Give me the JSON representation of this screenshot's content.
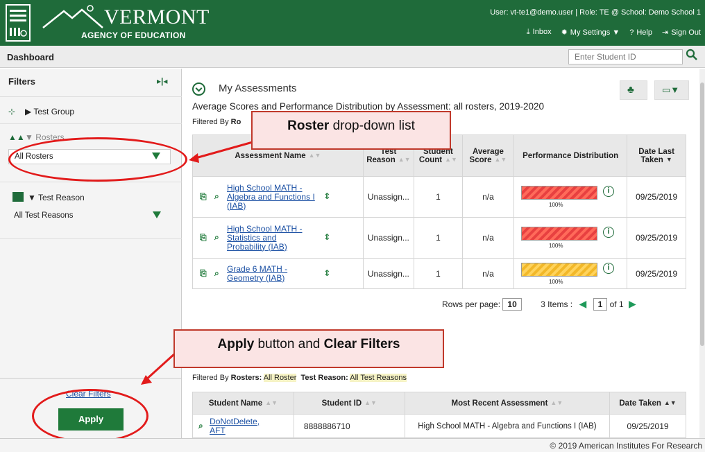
{
  "header": {
    "logo_line1": "VERMONT",
    "logo_line2": "AGENCY OF EDUCATION",
    "user_line": "User: vt-te1@demo.user  |  Role: TE @ School: Demo School 1",
    "links": {
      "inbox": "Inbox",
      "settings": "My Settings ▼",
      "help": "Help",
      "sign_out": "Sign Out"
    }
  },
  "dashboard": {
    "title": "Dashboard",
    "search_placeholder": "Enter Student ID"
  },
  "sidebar": {
    "title": "Filters",
    "test_group": "Test Group",
    "rosters_label": "Rosters",
    "rosters_value": "All Rosters",
    "test_reason_label": "Test Reason",
    "test_reason_value": "All Test Reasons",
    "clear_filters": "Clear Filters",
    "apply": "Apply"
  },
  "main": {
    "title": "My Assessments",
    "subtitle": "Average Scores and Performance Distribution by Assessment: all rosters, 2019-2020",
    "filtered_by_prefix": "Filtered By",
    "filtered_by_rosters": "Ro",
    "columns": [
      "Assessment Name",
      "Test Reason",
      "Student Count",
      "Average Score",
      "Performance Distribution",
      "Date Last Taken"
    ],
    "rows": [
      {
        "name": "High School MATH - Algebra and Functions I (IAB)",
        "reason": "Unassign...",
        "count": "1",
        "score": "n/a",
        "pct": "100%",
        "color": "#e84040",
        "date": "09/25/2019"
      },
      {
        "name": "High School MATH - Statistics and Probability (IAB)",
        "reason": "Unassign...",
        "count": "1",
        "score": "n/a",
        "pct": "100%",
        "color": "#e84040",
        "date": "09/25/2019"
      },
      {
        "name": "Grade 6 MATH - Geometry (IAB)",
        "reason": "Unassign...",
        "count": "1",
        "score": "n/a",
        "pct": "100%",
        "color": "#f2b829",
        "date": "09/25/2019"
      }
    ],
    "rows_per_page_label": "Rows per page:",
    "rows_per_page": "10",
    "items": "3 Items :",
    "page": "1",
    "of_pages": "of 1"
  },
  "students": {
    "filtered_by_prefix": "Filtered By",
    "rosters_label": "Rosters:",
    "rosters_value": "All Roster",
    "test_reason_label": "Test Reason:",
    "test_reason_value": "All Test Reasons",
    "columns": [
      "Student Name",
      "Student ID",
      "Most Recent Assessment",
      "Date Taken"
    ],
    "rows": [
      {
        "name": "DoNotDelete, AFT",
        "id": "8888886710",
        "assessment": "High School MATH - Algebra and Functions I (IAB)",
        "date": "09/25/2019"
      }
    ]
  },
  "callouts": {
    "roster_bold": "Roster",
    "roster_rest": " drop-down list",
    "apply_bold": "Apply",
    "apply_mid": " button and ",
    "apply_bold2": "Clear Filters"
  },
  "footer": "© 2019 American Institutes For Research",
  "colors": {
    "brand_green": "#1f6b3a",
    "button_green": "#1f7a3a",
    "callout_red": "#e21b1b",
    "fail_red": "#e84040",
    "warn_yellow": "#f2b829"
  }
}
